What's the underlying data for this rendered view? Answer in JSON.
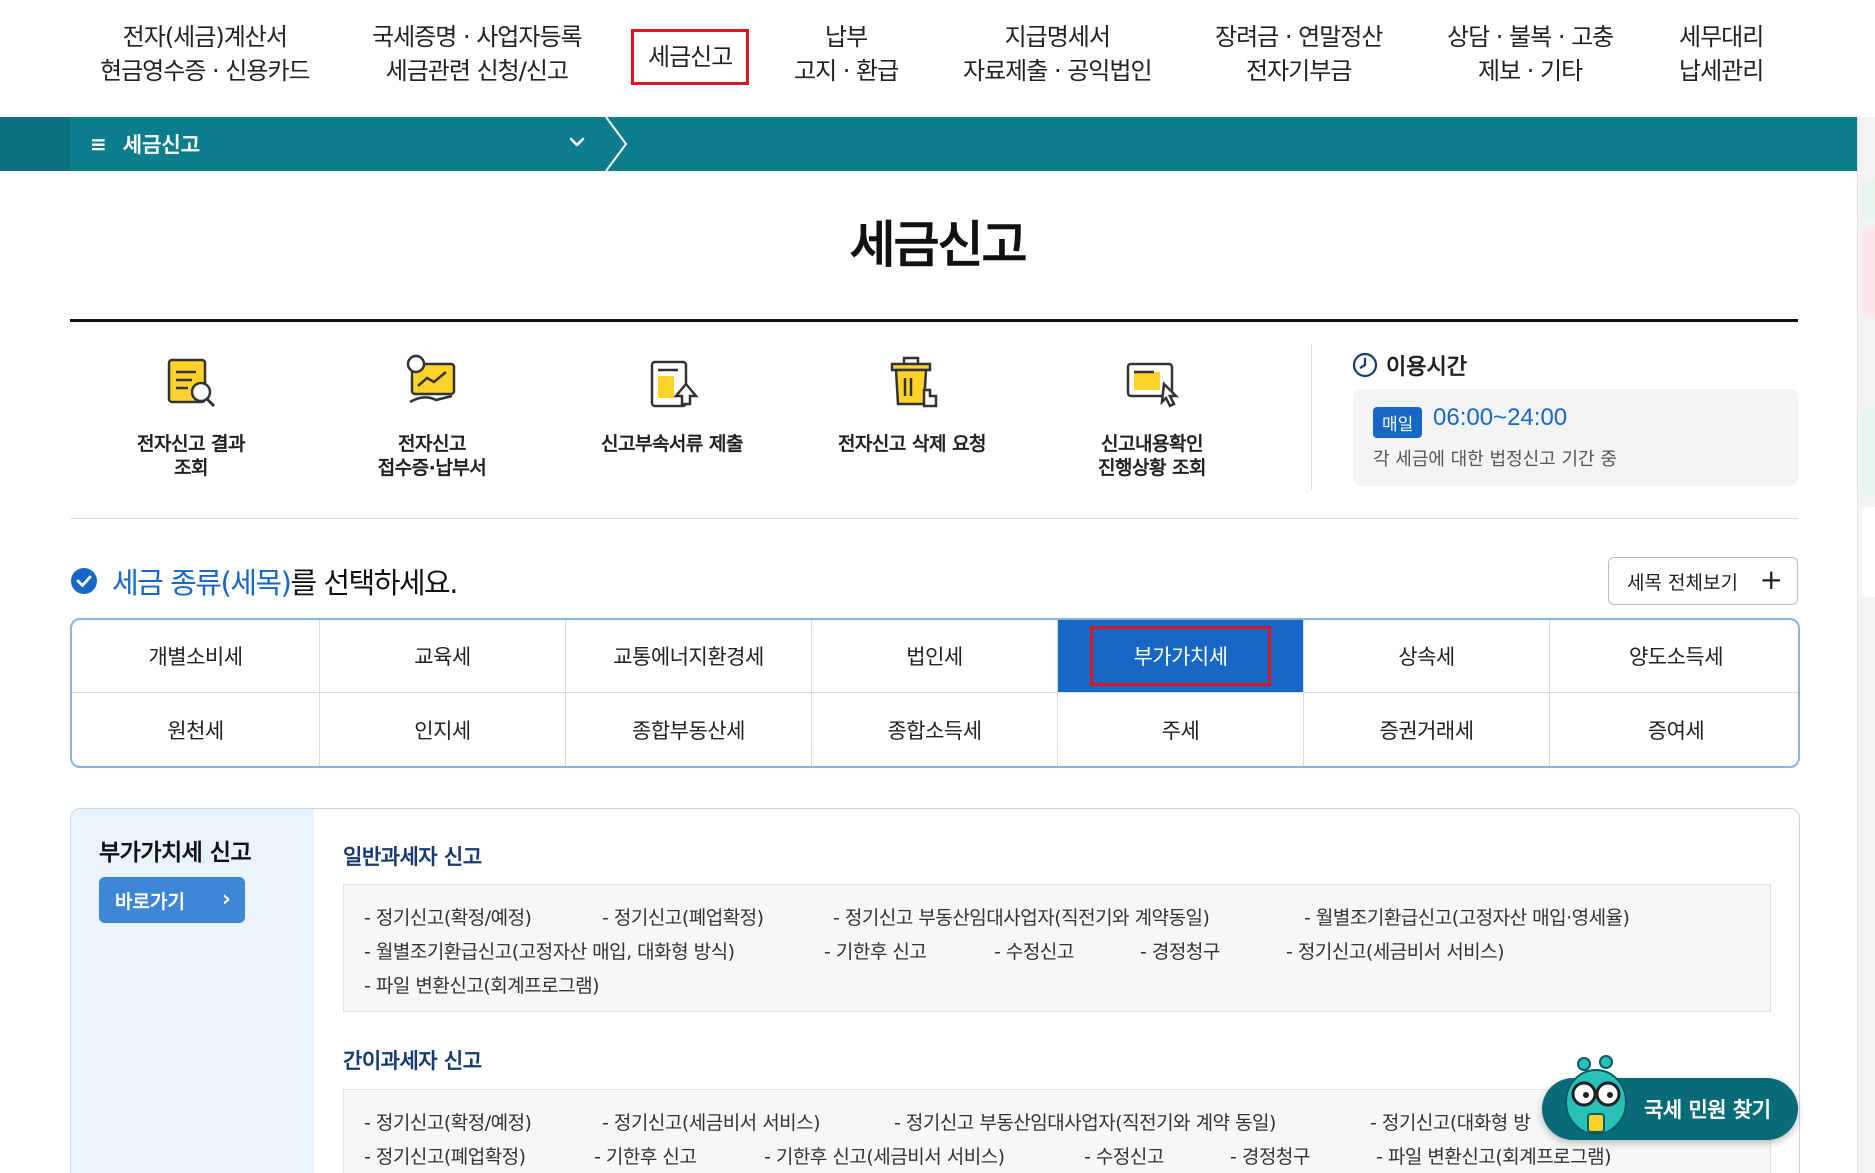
{
  "nav": {
    "items": [
      {
        "line1": "전자(세금)계산서",
        "line2": "현금영수증 · 신용카드"
      },
      {
        "line1": "국세증명 · 사업자등록",
        "line2": "세금관련 신청/신고"
      },
      {
        "line1": "세금신고",
        "line2": ""
      },
      {
        "line1": "납부",
        "line2": "고지 · 환급"
      },
      {
        "line1": "지급명세서",
        "line2": "자료제출 · 공익법인"
      },
      {
        "line1": "장려금 · 연말정산",
        "line2": "전자기부금"
      },
      {
        "line1": "상담 · 불복 · 고충",
        "line2": "제보 · 기타"
      },
      {
        "line1": "세무대리",
        "line2": "납세관리"
      }
    ]
  },
  "breadcrumb": {
    "menu_icon": "≡",
    "current": "세금신고"
  },
  "page": {
    "title": "세금신고"
  },
  "quick_links": [
    {
      "icon": "document-search-icon",
      "line1": "전자신고 결과",
      "line2": "조회"
    },
    {
      "icon": "receipt-chart-icon",
      "line1": "전자신고",
      "line2": "접수증·납부서"
    },
    {
      "icon": "document-upload-icon",
      "line1": "신고부속서류 제출",
      "line2": ""
    },
    {
      "icon": "trash-delete-icon",
      "line1": "전자신고 삭제 요청",
      "line2": ""
    },
    {
      "icon": "document-check-icon",
      "line1": "신고내용확인",
      "line2": "진행상황 조회"
    }
  ],
  "hours": {
    "title": "이용시간",
    "badge": "매일",
    "time": "06:00~24:00",
    "desc": "각 세금에 대한 법정신고 기간 중"
  },
  "select": {
    "highlight": "세금 종류(세목)",
    "rest": "를 선택하세요.",
    "view_all": "세목 전체보기",
    "view_all_icon": "+"
  },
  "tax_types": [
    [
      "개별소비세",
      "교육세",
      "교통에너지환경세",
      "법인세",
      "부가가치세",
      "상속세",
      "양도소득세"
    ],
    [
      "원천세",
      "인지세",
      "종합부동산세",
      "종합소득세",
      "주세",
      "증권거래세",
      "증여세"
    ]
  ],
  "selected_tax": "부가가치세",
  "vat": {
    "title": "부가가치세 신고",
    "go_label": "바로가기",
    "go_icon": "›",
    "general": {
      "title": "일반과세자 신고",
      "rows": [
        [
          "- 정기신고(확정/예정)",
          "- 정기신고(폐업확정)",
          "- 정기신고 부동산임대사업자(직전기와 계약동일)",
          "- 월별조기환급신고(고정자산 매입·영세율)"
        ],
        [
          "- 월별조기환급신고(고정자산 매입, 대화형 방식)",
          "- 기한후 신고",
          "- 수정신고",
          "- 경정청구",
          "- 정기신고(세금비서 서비스)"
        ],
        [
          "- 파일 변환신고(회계프로그램)"
        ]
      ]
    },
    "simple": {
      "title": "간이과세자 신고",
      "rows": [
        [
          "- 정기신고(확정/예정)",
          "- 정기신고(세금비서 서비스)",
          "- 정기신고 부동산임대사업자(직전기와 계약 동일)",
          "- 정기신고(대화형 방"
        ],
        [
          "- 정기신고(폐업확정)",
          "- 기한후 신고",
          "- 기한후 신고(세금비서 서비스)",
          "- 수정신고",
          "- 경정청구",
          "- 파일 변환신고(회계프로그램)"
        ]
      ]
    }
  },
  "float_button": {
    "label": "국세 민원 찾기"
  },
  "colors": {
    "teal": "#0b7d8c",
    "blue": "#1767c6",
    "highlight_red": "#e0141e"
  }
}
